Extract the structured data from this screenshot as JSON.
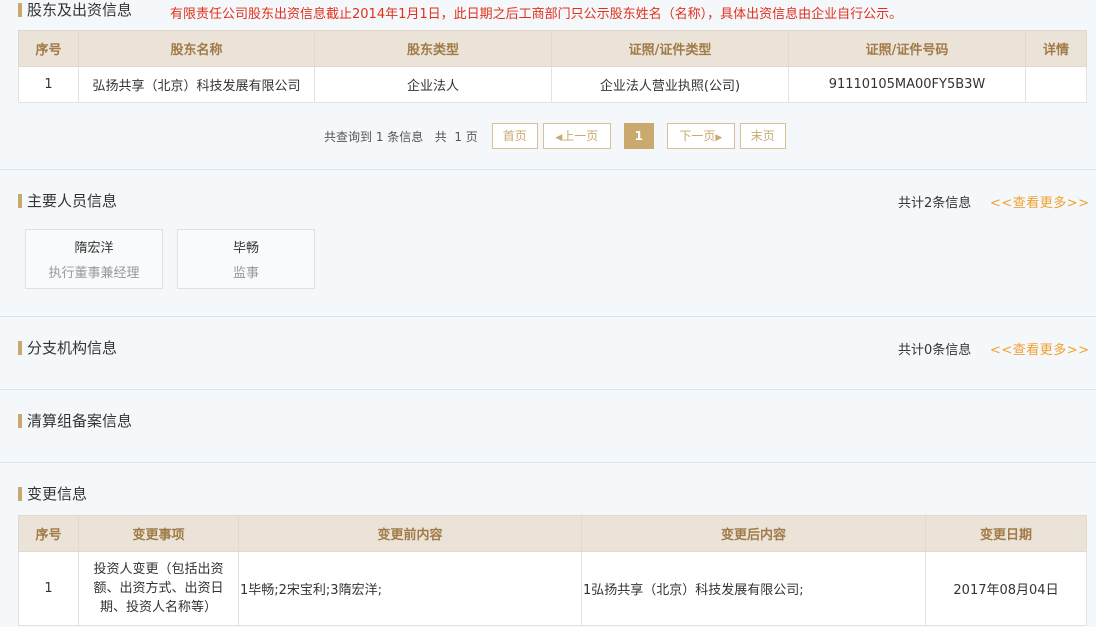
{
  "shareholders": {
    "title": "股东及出资信息",
    "notice": "有限责任公司股东出资信息截止2014年1月1日，此日期之后工商部门只公示股东姓名（名称），具体出资信息由企业自行公示。",
    "columns": [
      "序号",
      "股东名称",
      "股东类型",
      "证照/证件类型",
      "证照/证件号码",
      "详情"
    ],
    "rows": [
      [
        "1",
        "弘扬共享（北京）科技发展有限公司",
        "企业法人",
        "企业法人营业执照(公司)",
        "91110105MA00FY5B3W",
        ""
      ]
    ],
    "pager": {
      "info": "共查询到 1 条信息   共  1 页",
      "first": "首页",
      "prev": "上一页",
      "current": "1",
      "next": "下一页",
      "last": "末页"
    }
  },
  "personnel": {
    "title": "主要人员信息",
    "count": "共计2条信息",
    "more": "<<查看更多>>",
    "people": [
      {
        "name": "隋宏洋",
        "role": "执行董事兼经理"
      },
      {
        "name": "毕畅",
        "role": "监事"
      }
    ]
  },
  "branches": {
    "title": "分支机构信息",
    "count": "共计0条信息",
    "more": "<<查看更多>>"
  },
  "liquidation": {
    "title": "清算组备案信息"
  },
  "changes": {
    "title": "变更信息",
    "columns": [
      "序号",
      "变更事项",
      "变更前内容",
      "变更后内容",
      "变更日期"
    ],
    "rows": [
      [
        "1",
        "投资人变更（包括出资额、出资方式、出资日期、投资人名称等）",
        "1毕畅;2宋宝利;3隋宏洋;",
        "1弘扬共享（北京）科技发展有限公司;",
        "2017年08月04日"
      ]
    ]
  },
  "colors": {
    "accent": "#c9a96e",
    "header_bg": "#ebe3d8",
    "header_text": "#a07b48",
    "notice": "#e0301e",
    "more_link": "#f0a030"
  }
}
